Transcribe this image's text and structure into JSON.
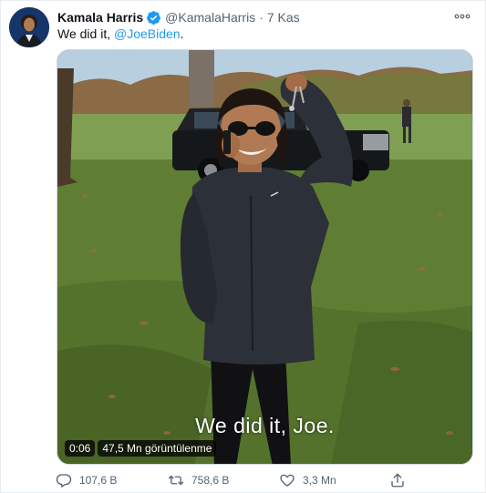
{
  "tweet": {
    "author_name": "Kamala Harris",
    "handle": "@KamalaHarris",
    "separator": "·",
    "time": "7 Kas",
    "text_prefix": "We did it, ",
    "mention": "@JoeBiden",
    "text_suffix": ".",
    "verified_icon": "verified-badge-icon",
    "more_icon": "more-options-icon"
  },
  "media": {
    "caption": "We did it, Joe.",
    "duration": "0:06",
    "views": "47,5 Mn görüntülenme"
  },
  "actions": {
    "replies": "107,6 B",
    "retweets": "758,6 B",
    "likes": "3,3 Mn",
    "reply_icon": "reply-icon",
    "retweet_icon": "retweet-icon",
    "like_icon": "heart-icon",
    "share_icon": "share-icon"
  },
  "colors": {
    "accent": "#1d9bf0",
    "secondary_text": "#536471"
  }
}
